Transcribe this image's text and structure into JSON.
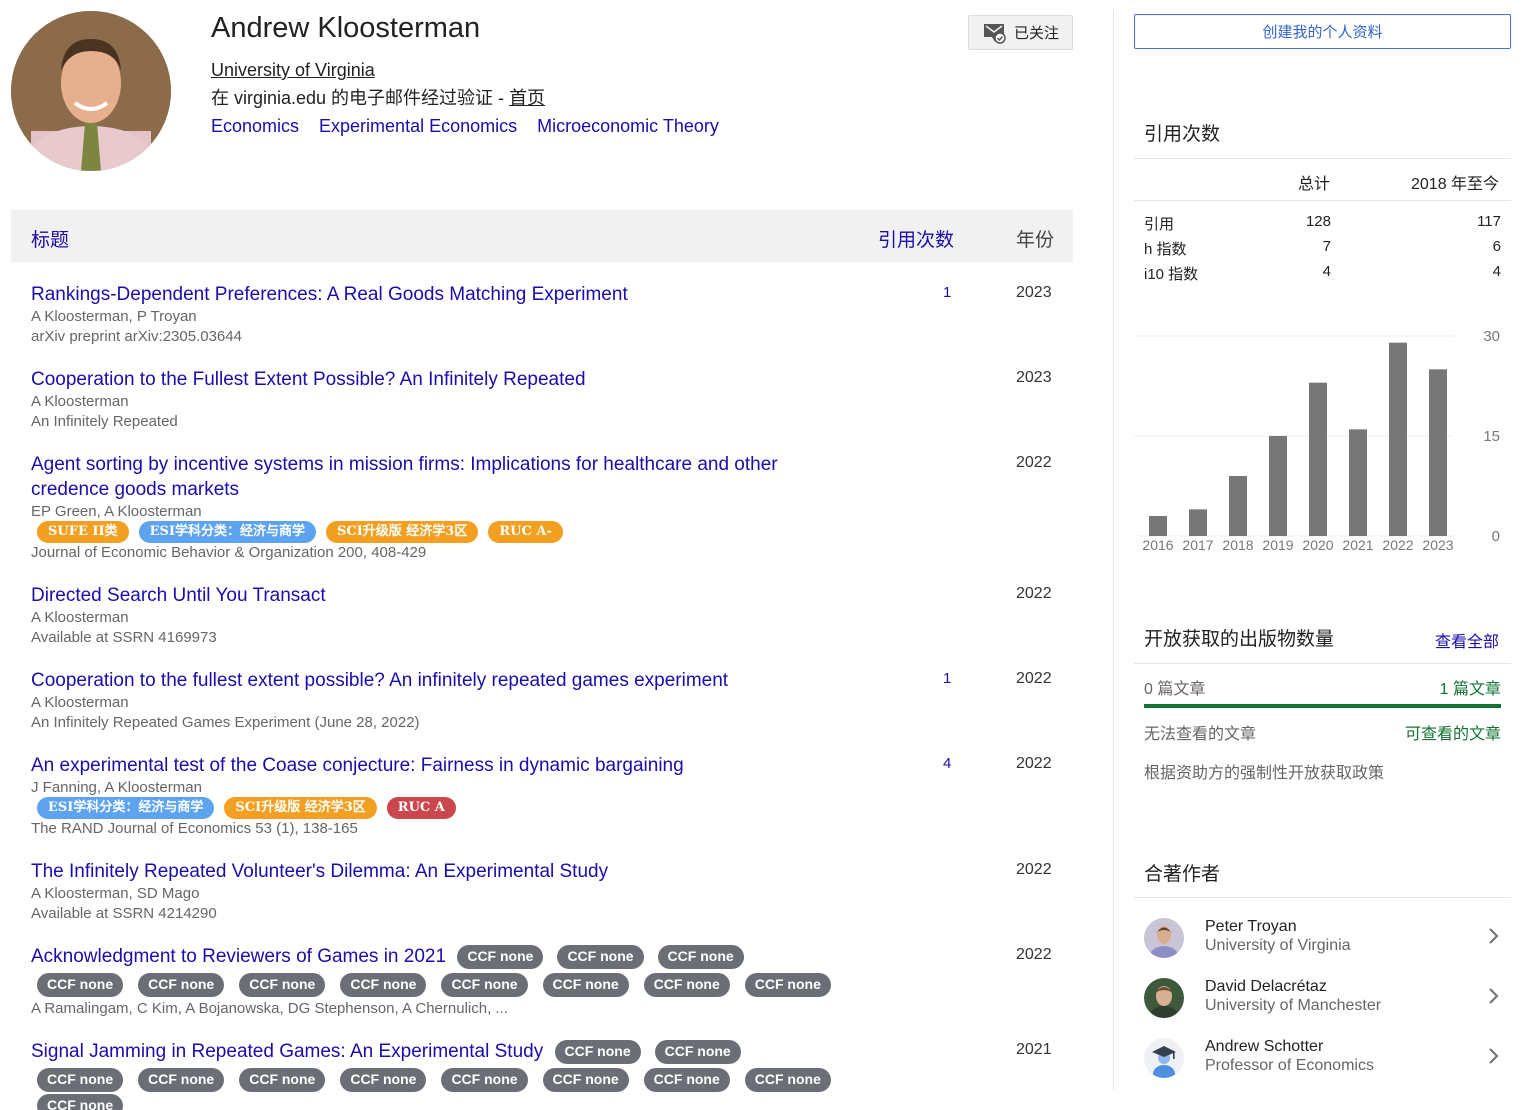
{
  "profile": {
    "name": "Andrew Kloosterman",
    "affiliation": "University of Virginia",
    "verified_prefix": "在 virginia.edu 的电子邮件经过验证 - ",
    "homepage_label": "首页",
    "interests": [
      "Economics",
      "Experimental Economics",
      "Microeconomic Theory"
    ],
    "follow_label": "已关注"
  },
  "table": {
    "col_title": "标题",
    "col_cites": "引用次数",
    "col_year": "年份"
  },
  "articles": [
    {
      "title": "Rankings-Dependent Preferences: A Real Goods Matching Experiment",
      "authors": "A Kloosterman, P Troyan",
      "venue": "arXiv preprint arXiv:2305.03644",
      "cites": "1",
      "year": "2023"
    },
    {
      "title": "Cooperation to the Fullest Extent Possible? An Infinitely Repeated",
      "authors": "A Kloosterman",
      "venue": "An Infinitely Repeated",
      "cites": "",
      "year": "2023"
    },
    {
      "title": "Agent sorting by incentive systems in mission firms: Implications for healthcare and other credence goods markets",
      "authors": "EP Green, A Kloosterman",
      "venue": "Journal of Economic Behavior & Organization 200, 408-429",
      "cites": "",
      "year": "2022",
      "tags": [
        {
          "label": "SUFE II类",
          "color": "orange"
        },
        {
          "label": "ESI学科分类：经济与商学",
          "color": "blue"
        },
        {
          "label": "SCI升级版 经济学3区",
          "color": "orange"
        },
        {
          "label": "RUC A-",
          "color": "orange"
        }
      ]
    },
    {
      "title": "Directed Search Until You Transact",
      "authors": "A Kloosterman",
      "venue": "Available at SSRN 4169973",
      "cites": "",
      "year": "2022"
    },
    {
      "title": "Cooperation to the fullest extent possible? An infinitely repeated games experiment",
      "authors": "A Kloosterman",
      "venue": "An Infinitely Repeated Games Experiment (June 28, 2022)",
      "cites": "1",
      "year": "2022"
    },
    {
      "title": "An experimental test of the Coase conjecture: Fairness in dynamic bargaining",
      "authors": "J Fanning, A Kloosterman",
      "venue": "The RAND Journal of Economics 53 (1), 138-165",
      "cites": "4",
      "year": "2022",
      "tags": [
        {
          "label": "ESI学科分类：经济与商学",
          "color": "blue"
        },
        {
          "label": "SCI升级版 经济学3区",
          "color": "orange"
        },
        {
          "label": "RUC A",
          "color": "red"
        }
      ]
    },
    {
      "title": "The Infinitely Repeated Volunteer's Dilemma: An Experimental Study",
      "authors": "A Kloosterman, SD Mago",
      "venue": "Available at SSRN 4214290",
      "cites": "",
      "year": "2022"
    },
    {
      "title": "Acknowledgment to Reviewers of Games in 2021",
      "authors": "A Ramalingam, C Kim, A Bojanowska, DG Stephenson, A Chernulich, ...",
      "venue": "",
      "cites": "",
      "year": "2022",
      "ccf_label": "CCF none"
    },
    {
      "title": "Signal Jamming in Repeated Games: An Experimental Study",
      "authors": "",
      "venue": "",
      "cites": "",
      "year": "2021",
      "ccf_label": "CCF none"
    }
  ],
  "sidebar": {
    "create_profile": "创建我的个人资料",
    "citations": {
      "title": "引用次数",
      "col_total": "总计",
      "col_since": "2018 年至今",
      "rows": [
        {
          "label": "引用",
          "total": "128",
          "since": "117"
        },
        {
          "label": "h 指数",
          "total": "7",
          "since": "6"
        },
        {
          "label": "i10 指数",
          "total": "4",
          "since": "4"
        }
      ]
    },
    "open_access": {
      "title": "开放获取的出版物数量",
      "view_all": "查看全部",
      "left_count": "0 篇文章",
      "right_count": "1 篇文章",
      "left_label": "无法查看的文章",
      "right_label": "可查看的文章",
      "note": "根据资助方的强制性开放获取政策"
    },
    "coauthors": {
      "title": "合著作者",
      "list": [
        {
          "name": "Peter Troyan",
          "affiliation": "University of Virginia"
        },
        {
          "name": "David Delacrétaz",
          "affiliation": "University of Manchester"
        },
        {
          "name": "Andrew Schotter",
          "affiliation": "Professor of Economics"
        }
      ]
    }
  },
  "chart_data": {
    "type": "bar",
    "categories": [
      "2016",
      "2017",
      "2018",
      "2019",
      "2020",
      "2021",
      "2022",
      "2023"
    ],
    "values": [
      3,
      4,
      9,
      15,
      23,
      16,
      29,
      25
    ],
    "yticks": [
      0,
      15,
      30
    ],
    "ylim": [
      0,
      30
    ],
    "bar_color": "#777777",
    "grid": true
  }
}
